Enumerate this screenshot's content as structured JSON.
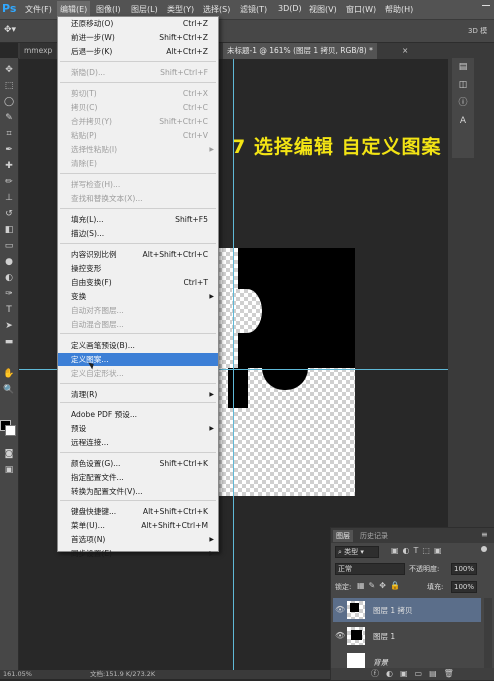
{
  "app": {
    "logo": "Ps"
  },
  "menubar": {
    "items": [
      "文件(F)",
      "编辑(E)",
      "图像(I)",
      "图层(L)",
      "类型(Y)",
      "选择(S)",
      "滤镜(T)",
      "3D(D)",
      "视图(V)",
      "窗口(W)",
      "帮助(H)"
    ]
  },
  "optionsbar": {
    "right_label": "3D 模"
  },
  "tabs": {
    "first": "mmexp",
    "active": "未标题-1 @ 161% (图层 1 拷贝, RGB/8) *",
    "close": "×"
  },
  "canvas": {
    "headline": "7  选择编辑  自定义图案"
  },
  "edit_menu": {
    "items": [
      {
        "label": "还原移动(O)",
        "shortcut": "Ctrl+Z",
        "disabled": false
      },
      {
        "label": "前进一步(W)",
        "shortcut": "Shift+Ctrl+Z",
        "disabled": false
      },
      {
        "label": "后退一步(K)",
        "shortcut": "Alt+Ctrl+Z",
        "disabled": false
      },
      {
        "label": "渐隐(D)...",
        "shortcut": "Shift+Ctrl+F",
        "disabled": true
      },
      {
        "label": "剪切(T)",
        "shortcut": "Ctrl+X",
        "disabled": true
      },
      {
        "label": "拷贝(C)",
        "shortcut": "Ctrl+C",
        "disabled": true
      },
      {
        "label": "合并拷贝(Y)",
        "shortcut": "Shift+Ctrl+C",
        "disabled": true
      },
      {
        "label": "粘贴(P)",
        "shortcut": "Ctrl+V",
        "disabled": true
      },
      {
        "label": "选择性粘贴(I)",
        "shortcut": "",
        "disabled": true,
        "submenu": true
      },
      {
        "label": "清除(E)",
        "shortcut": "",
        "disabled": true
      },
      {
        "label": "拼写检查(H)...",
        "shortcut": "",
        "disabled": true
      },
      {
        "label": "查找和替换文本(X)...",
        "shortcut": "",
        "disabled": true
      },
      {
        "label": "填充(L)...",
        "shortcut": "Shift+F5",
        "disabled": false
      },
      {
        "label": "描边(S)...",
        "shortcut": "",
        "disabled": false
      },
      {
        "label": "内容识别比例",
        "shortcut": "Alt+Shift+Ctrl+C",
        "disabled": false
      },
      {
        "label": "操控变形",
        "shortcut": "",
        "disabled": false
      },
      {
        "label": "自由变换(F)",
        "shortcut": "Ctrl+T",
        "disabled": false
      },
      {
        "label": "变换",
        "shortcut": "",
        "disabled": false,
        "submenu": true
      },
      {
        "label": "自动对齐图层...",
        "shortcut": "",
        "disabled": true
      },
      {
        "label": "自动混合图层...",
        "shortcut": "",
        "disabled": true
      },
      {
        "label": "定义画笔预设(B)...",
        "shortcut": "",
        "disabled": false
      },
      {
        "label": "定义图案...",
        "shortcut": "",
        "disabled": false,
        "highlighted": true
      },
      {
        "label": "定义自定形状...",
        "shortcut": "",
        "disabled": true
      },
      {
        "label": "清理(R)",
        "shortcut": "",
        "disabled": false,
        "submenu": true
      },
      {
        "label": "Adobe PDF 预设...",
        "shortcut": "",
        "disabled": false
      },
      {
        "label": "预设",
        "shortcut": "",
        "disabled": false,
        "submenu": true
      },
      {
        "label": "远程连接...",
        "shortcut": "",
        "disabled": false
      },
      {
        "label": "颜色设置(G)...",
        "shortcut": "Shift+Ctrl+K",
        "disabled": false
      },
      {
        "label": "指定配置文件...",
        "shortcut": "",
        "disabled": false
      },
      {
        "label": "转换为配置文件(V)...",
        "shortcut": "",
        "disabled": false
      },
      {
        "label": "键盘快捷键...",
        "shortcut": "Alt+Shift+Ctrl+K",
        "disabled": false
      },
      {
        "label": "菜单(U)...",
        "shortcut": "Alt+Shift+Ctrl+M",
        "disabled": false
      },
      {
        "label": "首选项(N)",
        "shortcut": "",
        "disabled": false,
        "submenu": true
      },
      {
        "label": "同步设置(E)",
        "shortcut": "",
        "disabled": false,
        "submenu": true
      }
    ]
  },
  "layers_panel": {
    "tabs": [
      "图层",
      "历史记录"
    ],
    "kind_filter": "类型",
    "blend_mode": "正常",
    "opacity_label": "不透明度:",
    "opacity_value": "100%",
    "lock_label": "锁定:",
    "fill_label": "填充:",
    "fill_value": "100%",
    "layers": [
      {
        "name": "图层 1 拷贝",
        "selected": true
      },
      {
        "name": "图层 1",
        "selected": false
      },
      {
        "name": "背景",
        "selected": false
      }
    ]
  },
  "statusbar": {
    "zoom": "161.05%",
    "doc": "文档:151.9 K/273.2K"
  },
  "colors": {
    "accent": "#3c7fd6",
    "headline": "#f3e414",
    "guide": "#5fb8d6"
  }
}
